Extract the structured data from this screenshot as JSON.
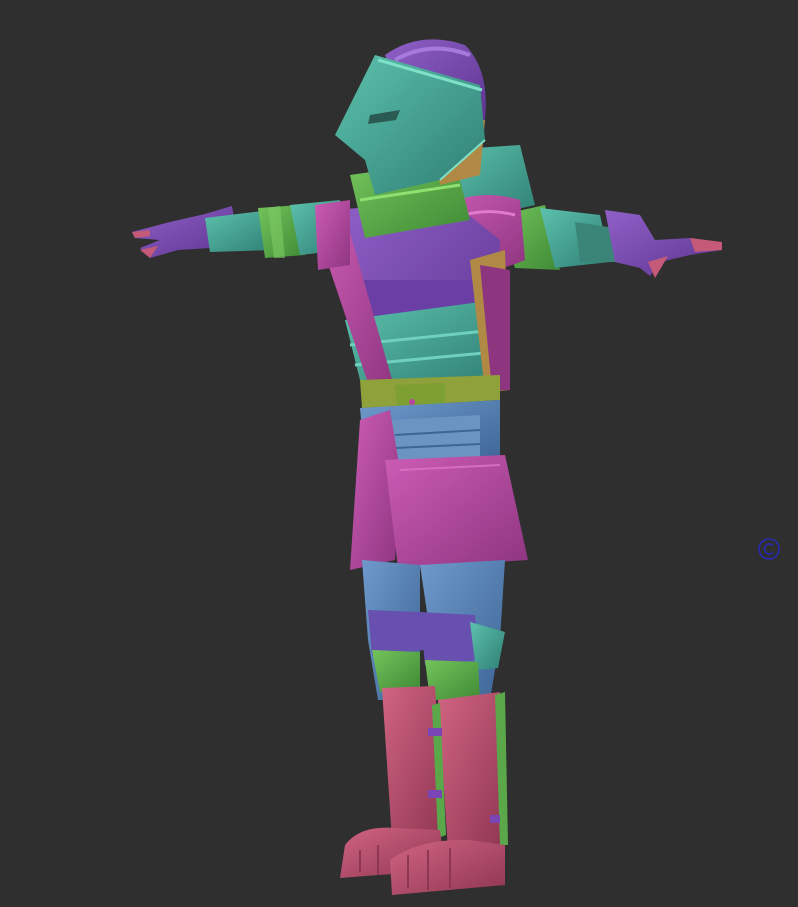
{
  "viewport": {
    "background": "#2f2f2f"
  },
  "model": {
    "subject": "armored-knight-t-pose",
    "palette": {
      "teal": "#3d9b8e",
      "teal_light": "#4fb3a3",
      "purple": "#7a45b5",
      "magenta": "#b6479f",
      "green": "#5aa84a",
      "olive": "#8fa13a",
      "blue": "#4b7cb0",
      "blue_light": "#6b94c2",
      "rose": "#b94c6b",
      "tan": "#b08a45"
    }
  },
  "gizmo": {
    "icon": "rotation-gizmo-icon",
    "color": "#2a2ab8"
  }
}
